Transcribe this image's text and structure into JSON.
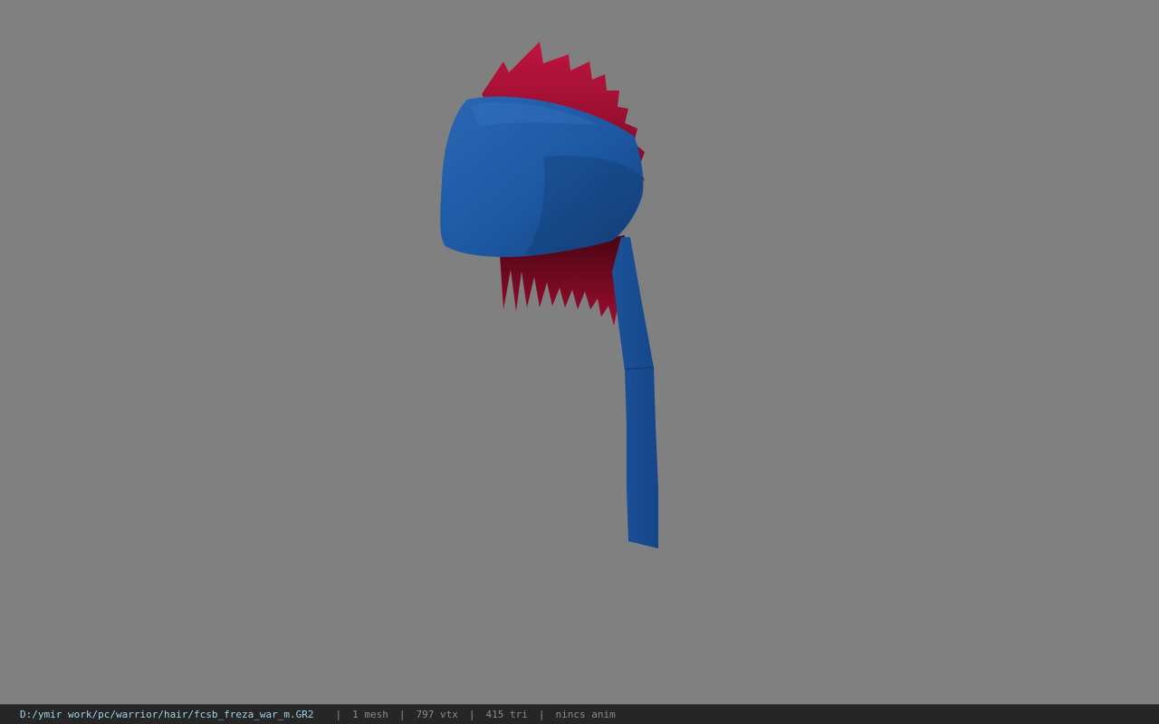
{
  "viewer": {
    "background_color": "#808080",
    "model": {
      "hat_color": "#1f5aa6",
      "hair_color": "#b5123a"
    }
  },
  "statusbar": {
    "file_path": "D:/ymir work/pc/warrior/hair/fcsb_freza_war_m.GR2",
    "separator": "|",
    "mesh_count": "1 mesh",
    "vertex_count": "797 vtx",
    "triangle_count": "415 tri",
    "anim_status": "nincs anim"
  }
}
